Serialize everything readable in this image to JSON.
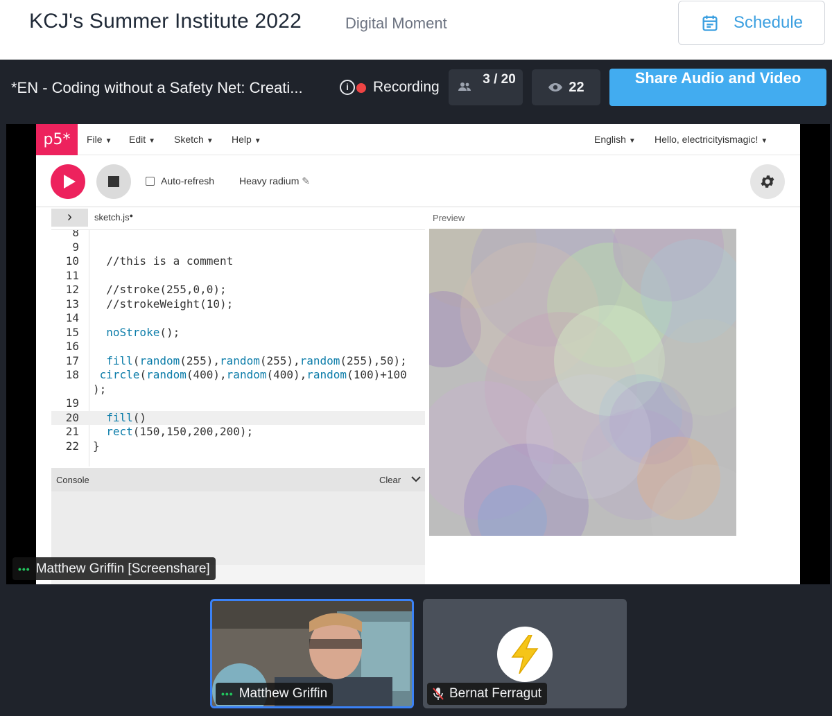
{
  "header": {
    "title": "KCJ's Summer Institute 2022",
    "subtitle": "Digital Moment",
    "schedule_label": "Schedule"
  },
  "session": {
    "title": "*EN - Coding without a Safety Net: Creati...",
    "recording_label": "Recording",
    "attendees": "3 / 20",
    "viewers": "22",
    "share_label": "Share Audio and Video"
  },
  "p5": {
    "logo": "p5*",
    "menus": [
      "File",
      "Edit",
      "Sketch",
      "Help"
    ],
    "language": "English",
    "user_greeting": "Hello, electricityismagic!",
    "auto_refresh_label": "Auto-refresh",
    "sketch_name": "Heavy radium",
    "file_tab": "sketch.js",
    "preview_label": "Preview",
    "console_label": "Console",
    "clear_label": "Clear",
    "code_lines": [
      {
        "num": "8",
        "code": ""
      },
      {
        "num": "9",
        "code": ""
      },
      {
        "num": "10",
        "code": "  //this is a comment"
      },
      {
        "num": "11",
        "code": ""
      },
      {
        "num": "12",
        "code": "  //stroke(255,0,0);"
      },
      {
        "num": "13",
        "code": "  //strokeWeight(10);"
      },
      {
        "num": "14",
        "code": ""
      },
      {
        "num": "15",
        "code": "  noStroke();"
      },
      {
        "num": "16",
        "code": ""
      },
      {
        "num": "17",
        "code": "  fill(random(255),random(255),random(255),50);"
      },
      {
        "num": "18",
        "code": " circle(random(400),random(400),random(100)+100"
      },
      {
        "num": "",
        "code": ");"
      },
      {
        "num": "19",
        "code": ""
      },
      {
        "num": "20",
        "code": "  fill()"
      },
      {
        "num": "21",
        "code": "  rect(150,150,200,200);"
      },
      {
        "num": "22",
        "code": "}"
      }
    ]
  },
  "participants": {
    "screenshare_name": "Matthew Griffin [Screenshare]",
    "video_name": "Matthew Griffin",
    "bernat_name": "Bernat Ferragut"
  },
  "colors": {
    "p5_pink": "#ed225d",
    "share_blue": "#42acf0",
    "recording_red": "#ef4444",
    "active_tile_border": "#3b82f6",
    "talking_green": "#22c55e"
  }
}
